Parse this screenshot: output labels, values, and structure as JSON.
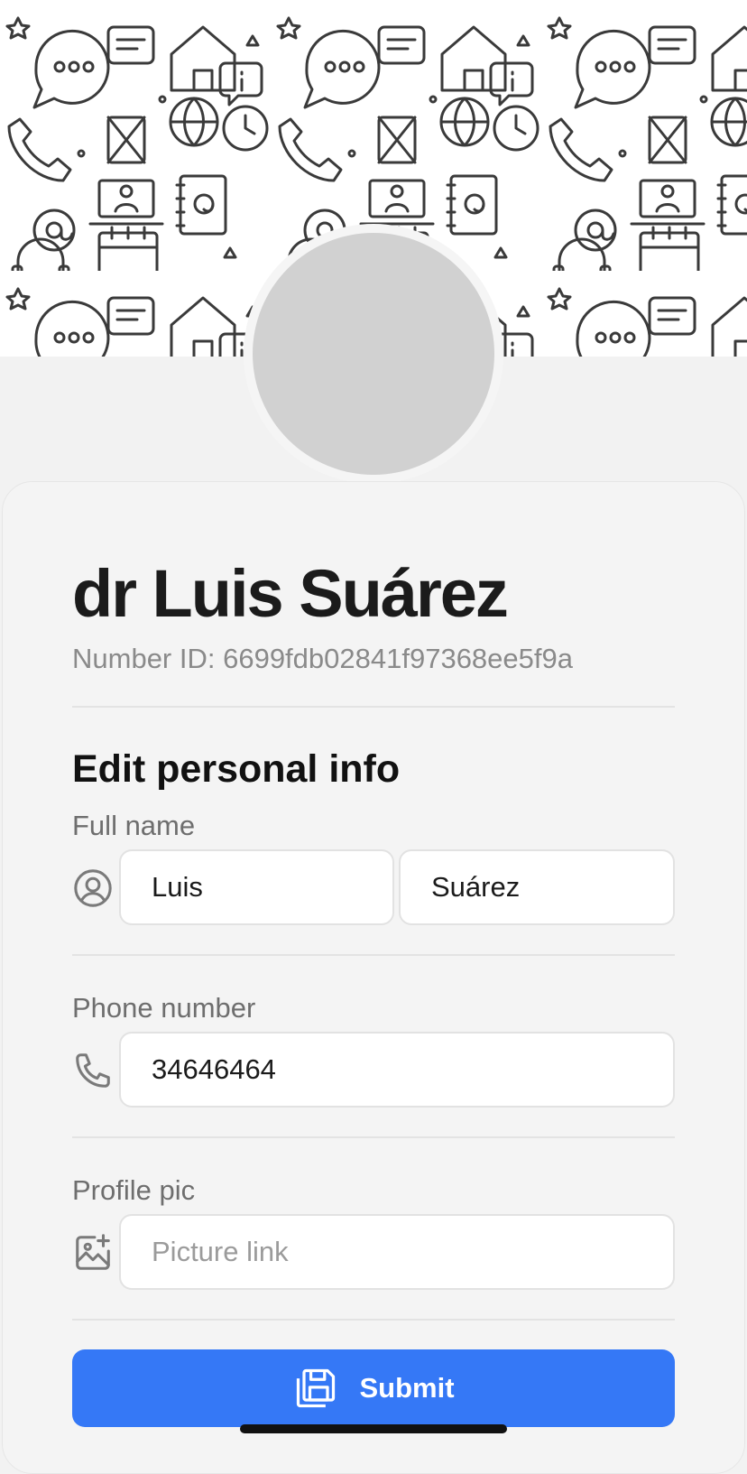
{
  "profile": {
    "display_name": "dr Luis Suárez",
    "id_line": "Number ID: 6699fdb02841f97368ee5f9a"
  },
  "form": {
    "section_title": "Edit personal info",
    "full_name": {
      "label": "Full name",
      "first_value": "Luis",
      "last_value": "Suárez",
      "icon": "user-circle-icon"
    },
    "phone": {
      "label": "Phone number",
      "value": "34646464",
      "icon": "phone-icon"
    },
    "profile_pic": {
      "label": "Profile pic",
      "placeholder": "Picture link",
      "value": "",
      "icon": "image-add-icon"
    },
    "submit_label": "Submit",
    "submit_icon": "save-icon"
  },
  "colors": {
    "accent": "#3578f6",
    "background": "#f2f2f2",
    "avatar_placeholder": "#d1d1d1"
  }
}
